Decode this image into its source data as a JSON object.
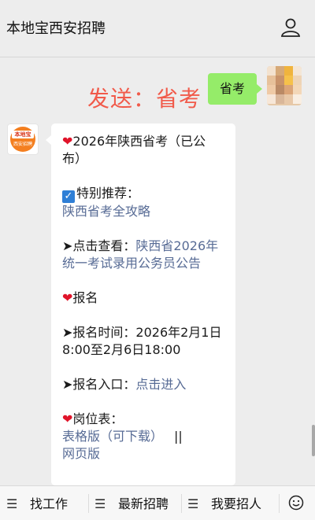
{
  "header": {
    "title": "本地宝西安招聘",
    "profile_icon": "user-icon"
  },
  "overlay_note": "发送：省考",
  "sent_message": "省考",
  "bot": {
    "avatar_top": "本地宝",
    "avatar_bottom": "西安招聘"
  },
  "reply": {
    "l1": "2026年陕西省考（已公",
    "l2": "布）",
    "rec_label": "特别推荐：",
    "rec_link": "陕西省考全攻略",
    "view_prefix": "➤点击查看：",
    "view_link_1": "陕西省2026年",
    "view_link_2": "统一考试录用公务员公告",
    "signup_title": "报名",
    "time_label": "➤报名时间：2026年2月1日",
    "time_value": "8:00至2月6日18:00",
    "entry_label": "➤报名入口：",
    "entry_link": "点击进入",
    "positions_title": "岗位表：",
    "positions_excel": "表格版（可下载）",
    "positions_sep": "||",
    "positions_web": "网页版"
  },
  "menu": {
    "items": [
      "找工作",
      "最新招聘",
      "我要招人"
    ],
    "hamburger_glyph": "☰",
    "emoji_icon": "smiley-icon"
  },
  "colors": {
    "accent_red": "#f15a4a",
    "bubble_green": "#95ec69",
    "link_blue": "#576b95"
  }
}
